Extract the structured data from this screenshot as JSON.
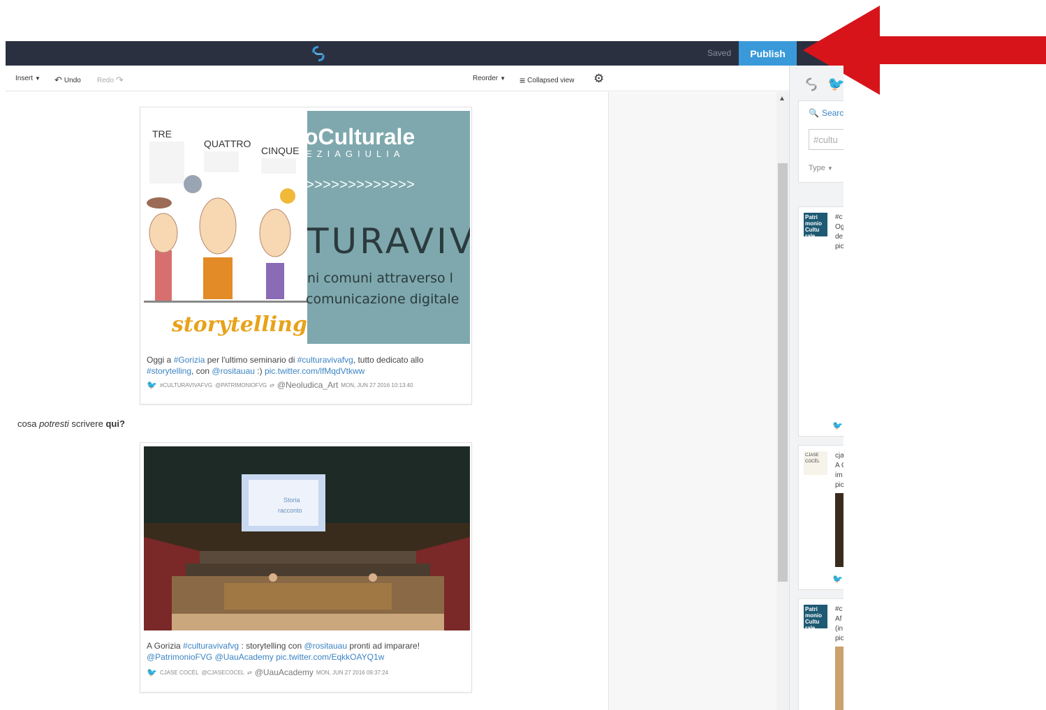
{
  "topbar": {
    "saved_label": "Saved",
    "publish_label": "Publish"
  },
  "toolbar": {
    "insert_label": "Insert",
    "undo_label": "Undo",
    "redo_label": "Redo",
    "reorder_label": "Reorder",
    "collapsed_label": "Collapsed view"
  },
  "story": {
    "item1": {
      "image_texts": {
        "tre": "TRE",
        "quattro": "QUATTRO",
        "cinque": "CINQUE",
        "culturale": "oCulturale",
        "region": "EZIAGIULIA",
        "chevrons": ">>>>>>>>>>>>>",
        "turaviv": "TURAVIV",
        "line1": "ni comuni attraverso l",
        "line2": "comunicazione digitale",
        "storytelling": "storytelling"
      },
      "caption_a": "Oggi a ",
      "caption_b": "#Gorizia",
      "caption_c": " per l'ultimo seminario di ",
      "caption_d": "#culturavivafvg",
      "caption_e": ", tutto dedicato allo",
      "caption_f": "#storytelling",
      "caption_g": ", con ",
      "caption_h": "@rositauau",
      "caption_i": " :) ",
      "caption_j": "pic.twitter.com/lfMqdVtkww",
      "meta_source": "#CULTURAVIVAFVG",
      "meta_via": "@PATRIMONIOFVG",
      "meta_handle": "@Neoludica_Art",
      "meta_date": "MON, JUN 27 2016 10:13:40"
    },
    "freetext_a": "cosa ",
    "freetext_b": "potresti",
    "freetext_c": " scrivere ",
    "freetext_d": "qui?",
    "item2": {
      "screen_line1": "Storia",
      "screen_line2": "racconto",
      "caption_a": "A Gorizia ",
      "caption_b": "#culturavivafvg",
      "caption_c": " : storytelling con ",
      "caption_d": "@rositauau",
      "caption_e": " pronti ad imparare!",
      "caption_f": "@PatrimonioFVG",
      "caption_g": " ",
      "caption_h": "@UauAcademy",
      "caption_i": " ",
      "caption_j": "pic.twitter.com/EqkkOAYQ1w",
      "meta_source": "CJASE COCÈL",
      "meta_via": "@CJASECOCEL",
      "meta_handle": "@UauAcademy",
      "meta_date": "MON, JUN 27 2016 09:37:24"
    }
  },
  "sidebar": {
    "search_label": "Searc",
    "search_value": "#cultu",
    "type_label": "Type",
    "results": [
      {
        "thumb": "Patri monio Cultu rale",
        "lines": [
          "#c",
          "Og",
          "de",
          "pic"
        ]
      },
      {
        "thumb": "CJASE COCÈL",
        "lines": [
          "cja",
          "A G",
          "im",
          "pic"
        ]
      },
      {
        "thumb": "Patri monio Cultu rale",
        "lines": [
          "#c",
          "Af",
          "(in",
          "pic"
        ]
      }
    ]
  },
  "colors": {
    "topbar": "#2b3040",
    "publish": "#3a9ad9",
    "link": "#3b84c4",
    "annotation_arrow": "#d8141b"
  }
}
